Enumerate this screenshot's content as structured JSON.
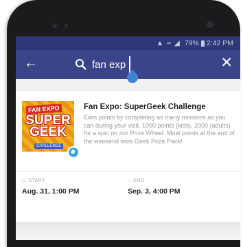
{
  "status_bar": {
    "battery": "79%",
    "time": "2:42 PM"
  },
  "toolbar": {
    "search_value": "fan exp",
    "search_placeholder": "Search"
  },
  "result": {
    "title": "Fan Expo: SuperGeek Challenge",
    "description": "Earn points by completing as many missions as you can during your visit. 1000 points (kids), 2000 (adults) for a spin on our Prize Wheel. Most points at the end of the weekend wins Geek Prize Pack!",
    "thumbnail": {
      "brand": "FAN EXPO",
      "headline": "SUPER GEEK",
      "tag": "CHALLENGE"
    },
    "start_label": "START",
    "start_value": "Aug. 31, 1:00 PM",
    "end_label": "END",
    "end_value": "Sep. 3, 4:00 PM"
  },
  "colors": {
    "status_bar": "#2e3876",
    "toolbar": "#3a4488",
    "accent_pin": "#3aa7e0",
    "text_handle": "#3f86d2"
  },
  "icons": [
    "back-arrow-icon",
    "search-icon",
    "close-icon",
    "location-pin-icon",
    "flag-icon",
    "clock-icon"
  ]
}
